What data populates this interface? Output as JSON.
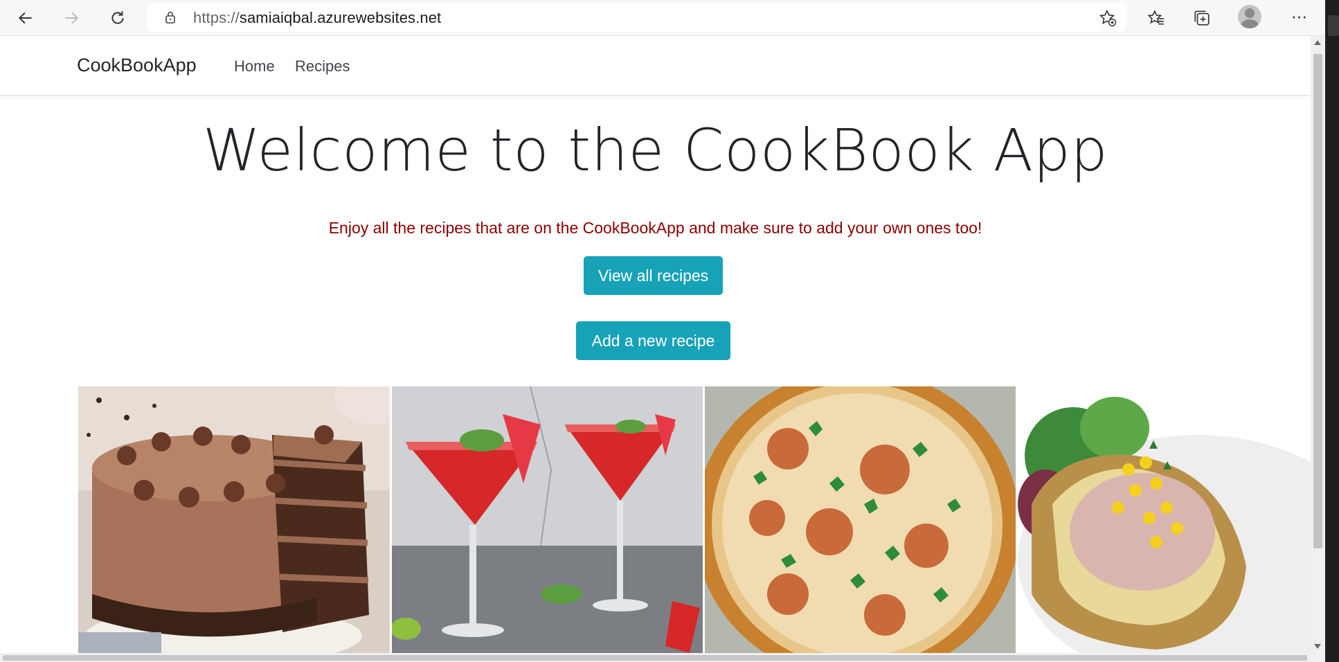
{
  "browser": {
    "url_scheme": "https://",
    "url_host": "samiaiqbal.azurewebsites.net",
    "menu_label": "···"
  },
  "site": {
    "brand": "CookBookApp",
    "nav": [
      {
        "label": "Home"
      },
      {
        "label": "Recipes"
      }
    ]
  },
  "hero": {
    "title": "Welcome to the CookBook App",
    "subtitle": "Enjoy all the recipes that are on the CookBookApp and make sure to add your own ones too!",
    "view_button": "View all recipes",
    "add_button": "Add a new recipe"
  },
  "gallery": {
    "images": [
      {
        "subject": "chocolate layer cake"
      },
      {
        "subject": "strawberry cocktails"
      },
      {
        "subject": "pizza with herbs"
      },
      {
        "subject": "baked potato with tuna and corn"
      }
    ]
  },
  "colors": {
    "accent_button": "#17a2b8",
    "subtitle_text": "#8b0000"
  }
}
